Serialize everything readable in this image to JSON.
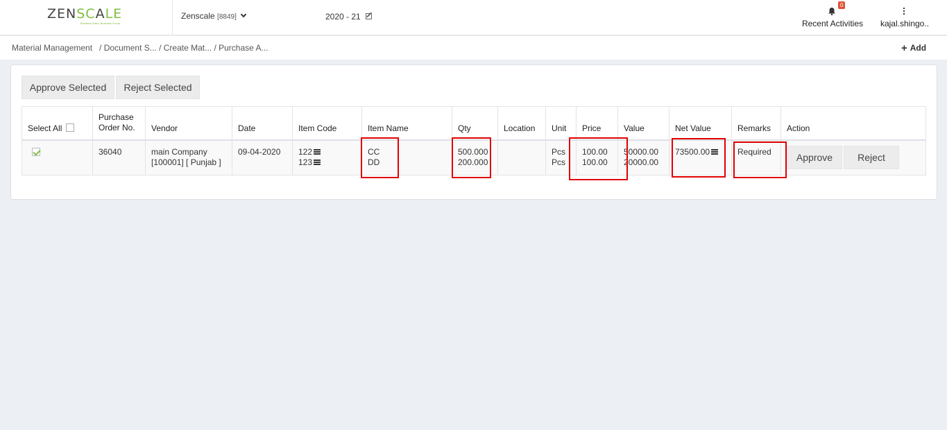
{
  "header": {
    "logo": {
      "zen": "ZEN",
      "sc": "SC",
      "a": "A",
      "le": "LE",
      "tagline": "Business Ease, Business Focus"
    },
    "company": "Zenscale",
    "company_code": "[8849]",
    "year": "2020 - 21",
    "notifications_count": "0",
    "recent_label": "Recent Activities",
    "user_label": "kajal.shingo.."
  },
  "breadcrumb": "Material Management   / Document S... / Create Mat... / Purchase A...",
  "add_label": "Add",
  "toolbar": {
    "approve_selected": "Approve Selected",
    "reject_selected": "Reject Selected"
  },
  "table": {
    "headers": {
      "select_all": "Select All",
      "po_line1": "Purchase",
      "po_line2": "Order No.",
      "vendor": "Vendor",
      "date": "Date",
      "item_code": "Item Code",
      "item_name": "Item Name",
      "qty": "Qty",
      "location": "Location",
      "unit": "Unit",
      "price": "Price",
      "value": "Value",
      "net_value": "Net Value",
      "remarks": "Remarks",
      "action": "Action"
    },
    "rows": [
      {
        "checked": true,
        "po_no": "36040",
        "vendor_line1": "main Company",
        "vendor_line2": "[100001] [ Punjab ]",
        "date": "09-04-2020",
        "item_codes": [
          "122",
          "123"
        ],
        "item_names": [
          "CC",
          "DD"
        ],
        "qtys": [
          "500.000",
          "200.000"
        ],
        "location": "",
        "units": [
          "Pcs",
          "Pcs"
        ],
        "prices": [
          "100.00",
          "100.00"
        ],
        "values": [
          "50000.00",
          "20000.00"
        ],
        "net_value": "73500.00",
        "remarks": "Required",
        "approve_label": "Approve",
        "reject_label": "Reject"
      }
    ]
  },
  "colors": {
    "accent": "#7fbf3f",
    "highlight": "#e00000",
    "badge": "#e0533b"
  }
}
